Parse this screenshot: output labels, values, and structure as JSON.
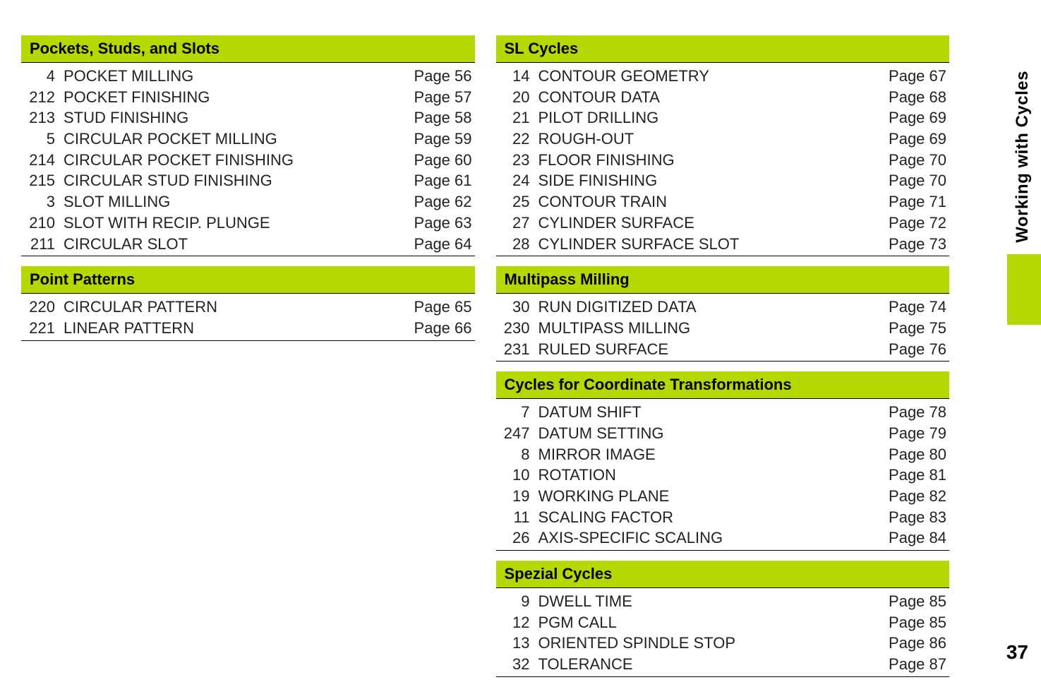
{
  "sideLabel": "Working with Cycles",
  "pageNumber": "37",
  "left": [
    {
      "title": "Pockets, Studs, and Slots",
      "rows": [
        {
          "num": "4",
          "name": "POCKET MILLING",
          "page": "Page 56"
        },
        {
          "num": "212",
          "name": "POCKET FINISHING",
          "page": "Page 57"
        },
        {
          "num": "213",
          "name": "STUD FINISHING",
          "page": "Page 58"
        },
        {
          "num": "5",
          "name": "CIRCULAR POCKET MILLING",
          "page": "Page 59"
        },
        {
          "num": "214",
          "name": "CIRCULAR POCKET FINISHING",
          "page": "Page 60"
        },
        {
          "num": "215",
          "name": "CIRCULAR STUD FINISHING",
          "page": "Page 61"
        },
        {
          "num": "3",
          "name": "SLOT MILLING",
          "page": "Page 62"
        },
        {
          "num": "210",
          "name": "SLOT WITH RECIP. PLUNGE",
          "page": "Page 63"
        },
        {
          "num": "211",
          "name": "CIRCULAR SLOT",
          "page": "Page 64"
        }
      ]
    },
    {
      "title": "Point Patterns",
      "rows": [
        {
          "num": "220",
          "name": "CIRCULAR PATTERN",
          "page": "Page 65"
        },
        {
          "num": "221",
          "name": "LINEAR PATTERN",
          "page": "Page 66"
        }
      ]
    }
  ],
  "right": [
    {
      "title": "SL Cycles",
      "rows": [
        {
          "num": "14",
          "name": "CONTOUR GEOMETRY",
          "page": "Page 67"
        },
        {
          "num": "20",
          "name": "CONTOUR DATA",
          "page": "Page 68"
        },
        {
          "num": "21",
          "name": "PILOT DRILLING",
          "page": "Page 69"
        },
        {
          "num": "22",
          "name": "ROUGH-OUT",
          "page": "Page 69"
        },
        {
          "num": "23",
          "name": "FLOOR FINISHING",
          "page": "Page 70"
        },
        {
          "num": "24",
          "name": "SIDE FINISHING",
          "page": "Page 70"
        },
        {
          "num": "25",
          "name": "CONTOUR TRAIN",
          "page": "Page 71"
        },
        {
          "num": "27",
          "name": "CYLINDER SURFACE",
          "page": "Page 72"
        },
        {
          "num": "28",
          "name": "CYLINDER SURFACE SLOT",
          "page": "Page 73"
        }
      ]
    },
    {
      "title": "Multipass Milling",
      "rows": [
        {
          "num": "30",
          "name": "RUN DIGITIZED DATA",
          "page": "Page 74"
        },
        {
          "num": "230",
          "name": "MULTIPASS MILLING",
          "page": "Page 75"
        },
        {
          "num": "231",
          "name": "RULED SURFACE",
          "page": "Page 76"
        }
      ]
    },
    {
      "title": "Cycles for Coordinate Transformations",
      "rows": [
        {
          "num": "7",
          "name": "DATUM SHIFT",
          "page": "Page 78"
        },
        {
          "num": "247",
          "name": "DATUM SETTING",
          "page": "Page 79"
        },
        {
          "num": "8",
          "name": "MIRROR IMAGE",
          "page": "Page 80"
        },
        {
          "num": "10",
          "name": "ROTATION",
          "page": "Page 81"
        },
        {
          "num": "19",
          "name": "WORKING PLANE",
          "page": "Page 82"
        },
        {
          "num": "11",
          "name": "SCALING FACTOR",
          "page": "Page 83"
        },
        {
          "num": "26",
          "name": "AXIS-SPECIFIC SCALING",
          "page": "Page 84"
        }
      ]
    },
    {
      "title": "Spezial Cycles",
      "rows": [
        {
          "num": "9",
          "name": "DWELL TIME",
          "page": "Page 85"
        },
        {
          "num": "12",
          "name": "PGM CALL",
          "page": "Page 85"
        },
        {
          "num": "13",
          "name": "ORIENTED SPINDLE STOP",
          "page": "Page 86"
        },
        {
          "num": "32",
          "name": "TOLERANCE",
          "page": "Page 87"
        }
      ]
    }
  ]
}
